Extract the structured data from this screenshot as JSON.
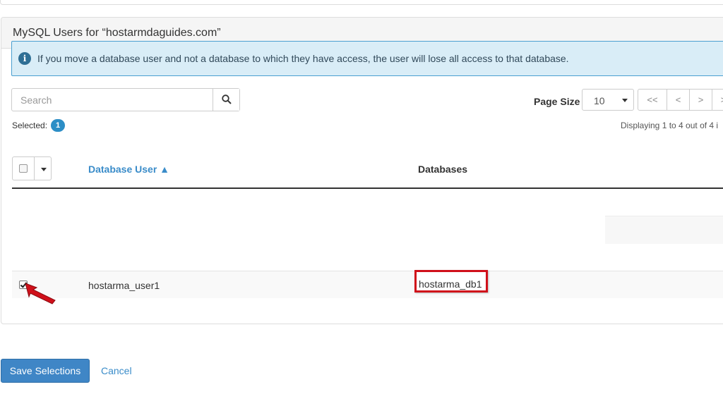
{
  "panel": {
    "title": "MySQL Users for “hostarmdaguides.com”"
  },
  "alert": {
    "icon": "info-icon",
    "text": "If you move a database user and not a database to which they have access, the user will lose all access to that database."
  },
  "search": {
    "placeholder": "Search",
    "value": ""
  },
  "paging": {
    "page_size_label": "Page Size",
    "page_size_value": "10",
    "buttons": [
      "<<",
      "<",
      ">",
      ">"
    ],
    "displaying": "Displaying 1 to 4 out of 4 i"
  },
  "selection": {
    "label": "Selected:",
    "count": "1"
  },
  "table": {
    "columns": {
      "user": "Database User ▲",
      "databases": "Databases"
    },
    "rows": [
      {
        "user": "hostarma_user1",
        "database": "hostarma_db1",
        "checked": true
      }
    ]
  },
  "actions": {
    "save_label": "Save Selections",
    "cancel_label": "Cancel"
  },
  "colors": {
    "primary": "#3f86c6",
    "link": "#3a8cc9",
    "badge": "#2c8ec6",
    "alert_bg": "#d9edf7",
    "highlight": "#d0101a"
  }
}
